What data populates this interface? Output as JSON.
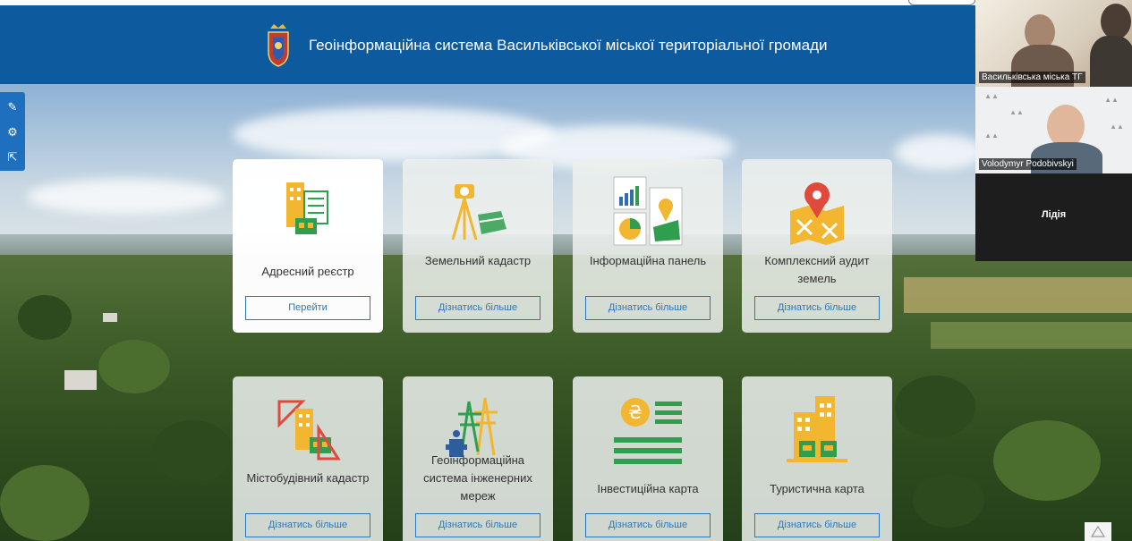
{
  "header": {
    "title": "Геоінформаційна система Васильківської міської територіальної громади"
  },
  "colors": {
    "header_bg": "#0e5a9e",
    "accent": "#2c77b9",
    "icon_yellow": "#f2b630",
    "icon_green": "#2f9e4f",
    "icon_red": "#e0493b"
  },
  "toolbar": {
    "items": [
      {
        "icon": "pencil-icon"
      },
      {
        "icon": "gear-icon"
      },
      {
        "icon": "share-icon"
      }
    ]
  },
  "cards": [
    {
      "title": "Адресний реєстр",
      "button": "Перейти",
      "icon": "address-registry-icon"
    },
    {
      "title": "Земельний кадастр",
      "button": "Дізнатись більше",
      "icon": "land-cadastre-icon"
    },
    {
      "title": "Інформаційна панель",
      "button": "Дізнатись більше",
      "icon": "dashboard-icon"
    },
    {
      "title": "Комплексний аудит земель",
      "button": "Дізнатись більше",
      "icon": "land-audit-icon"
    },
    {
      "title": "Містобудівний кадастр",
      "button": "Дізнатись більше",
      "icon": "urban-cadastre-icon"
    },
    {
      "title": "Геоінформаційна система інженерних мереж",
      "button": "Дізнатись більше",
      "icon": "engineering-networks-icon"
    },
    {
      "title": "Інвестиційна карта",
      "button": "Дізнатись більше",
      "icon": "investment-map-icon"
    },
    {
      "title": "Туристична карта",
      "button": "Дізнатись більше",
      "icon": "tourist-map-icon"
    }
  ],
  "video": {
    "participants": [
      {
        "name": "Васильківська міська ТГ"
      },
      {
        "name": "Volodymyr Podobivskyi"
      },
      {
        "name": "Лідія"
      }
    ]
  }
}
